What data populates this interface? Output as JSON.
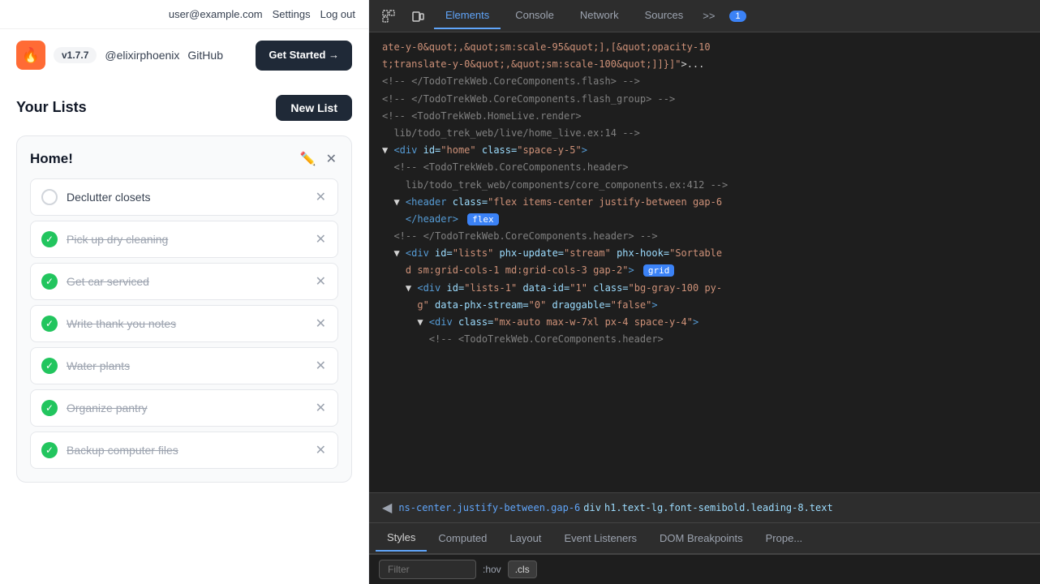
{
  "topbar": {
    "user_email": "user@example.com",
    "settings_label": "Settings",
    "logout_label": "Log out"
  },
  "logobar": {
    "version": "v1.7.7",
    "handle": "@elixirphoenix",
    "github_label": "GitHub",
    "get_started_label": "Get Started →"
  },
  "lists_section": {
    "title": "Your Lists",
    "new_list_btn": "New List"
  },
  "home_list": {
    "title": "Home!",
    "todos": [
      {
        "id": 1,
        "text": "Declutter closets",
        "completed": false
      },
      {
        "id": 2,
        "text": "Pick up dry cleaning",
        "completed": true
      },
      {
        "id": 3,
        "text": "Get car serviced",
        "completed": true
      },
      {
        "id": 4,
        "text": "Write thank you notes",
        "completed": true
      },
      {
        "id": 5,
        "text": "Water plants",
        "completed": true
      },
      {
        "id": 6,
        "text": "Organize pantry",
        "completed": true
      },
      {
        "id": 7,
        "text": "Backup computer files",
        "completed": true
      }
    ]
  },
  "devtools": {
    "tabs": [
      "Elements",
      "Console",
      "Network",
      "Sources",
      ">>"
    ],
    "active_tab": "Elements",
    "badge_count": "1",
    "bottom_tabs": [
      "Styles",
      "Computed",
      "Layout",
      "Event Listeners",
      "DOM Breakpoints",
      "Prope..."
    ],
    "active_bottom_tab": "Styles",
    "filter_placeholder": "Filter",
    "filter_pseudo": ":hov",
    "filter_cls": ".cls",
    "breadcrumb": "ns-center.justify-between.gap-6",
    "breadcrumb_div": "div",
    "breadcrumb_h1": "h1.text-lg.font-semibold.leading-8.text",
    "code_lines": [
      "ate-y-0&quot;,&quot;sm:scale-95&quot;],[&quot;opacity-10",
      "t;translate-y-0&quot;,&quot;sm:scale-100&quot;]]}]\">...",
      "<!-- </TodoTrekWeb.CoreComponents.flash> -->",
      "<!-- </TodoTrekWeb.CoreComponents.flash_group> -->",
      "<!-- <TodoTrekWeb.HomeLive.render>",
      "  lib/todo_trek_web/live/home_live.ex:14 -->",
      "▼ <div id=\"home\" class=\"space-y-5\">",
      "  <!-- <TodoTrekWeb.CoreComponents.header>",
      "    lib/todo_trek_web/components/core_components.ex:412 -->",
      "  ▼ <header class=\"flex items-center justify-between gap-6",
      "    </header> flex",
      "  <!-- </TodoTrekWeb.CoreComponents.header> -->",
      "  ▼ <div id=\"lists\" phx-update=\"stream\" phx-hook=\"Sortable",
      "    d sm:grid-cols-1 md:grid-cols-3 gap-2\"> grid",
      "    ▼ <div id=\"lists-1\" data-id=\"1\" class=\"bg-gray-100 py-",
      "      g\" data-phx-stream=\"0\" draggable=\"false\">",
      "      ▼ <div class=\"mx-auto max-w-7xl px-4 space-y-4\">",
      "        <!-- <TodoTrekWeb.CoreComponents.header>"
    ]
  }
}
